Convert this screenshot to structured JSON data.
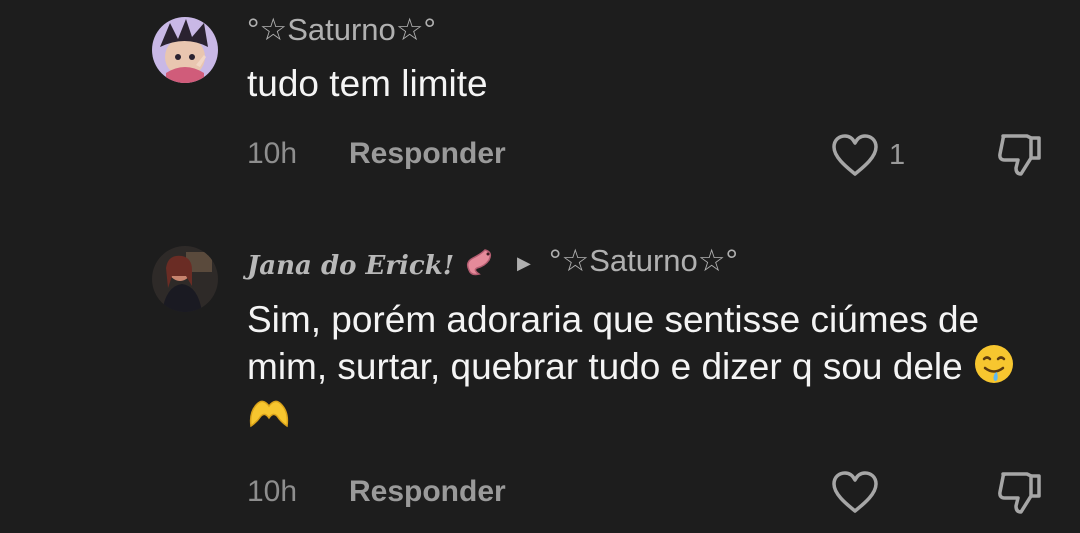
{
  "comments": [
    {
      "username": "°☆Saturno☆°",
      "text": "tudo tem limite",
      "time": "10h",
      "reply_label": "Responder",
      "like_count": "1"
    },
    {
      "username": "Jana do Erick!",
      "reply_to": "°☆Saturno☆°",
      "text": "Sim, porém adoraria que sentisse ciúmes de mim, surtar, quebrar tudo e dizer q sou dele",
      "time": "10h",
      "reply_label": "Responder",
      "like_count": ""
    }
  ],
  "icons": {
    "like": "heart-outline-icon",
    "dislike": "thumbs-down-icon",
    "reply_arrow": "triangle-right-icon"
  },
  "colors": {
    "background": "#1d1d1d",
    "username": "#b0b0b0",
    "text": "#f4f4f4",
    "meta": "#9a9a9a"
  }
}
